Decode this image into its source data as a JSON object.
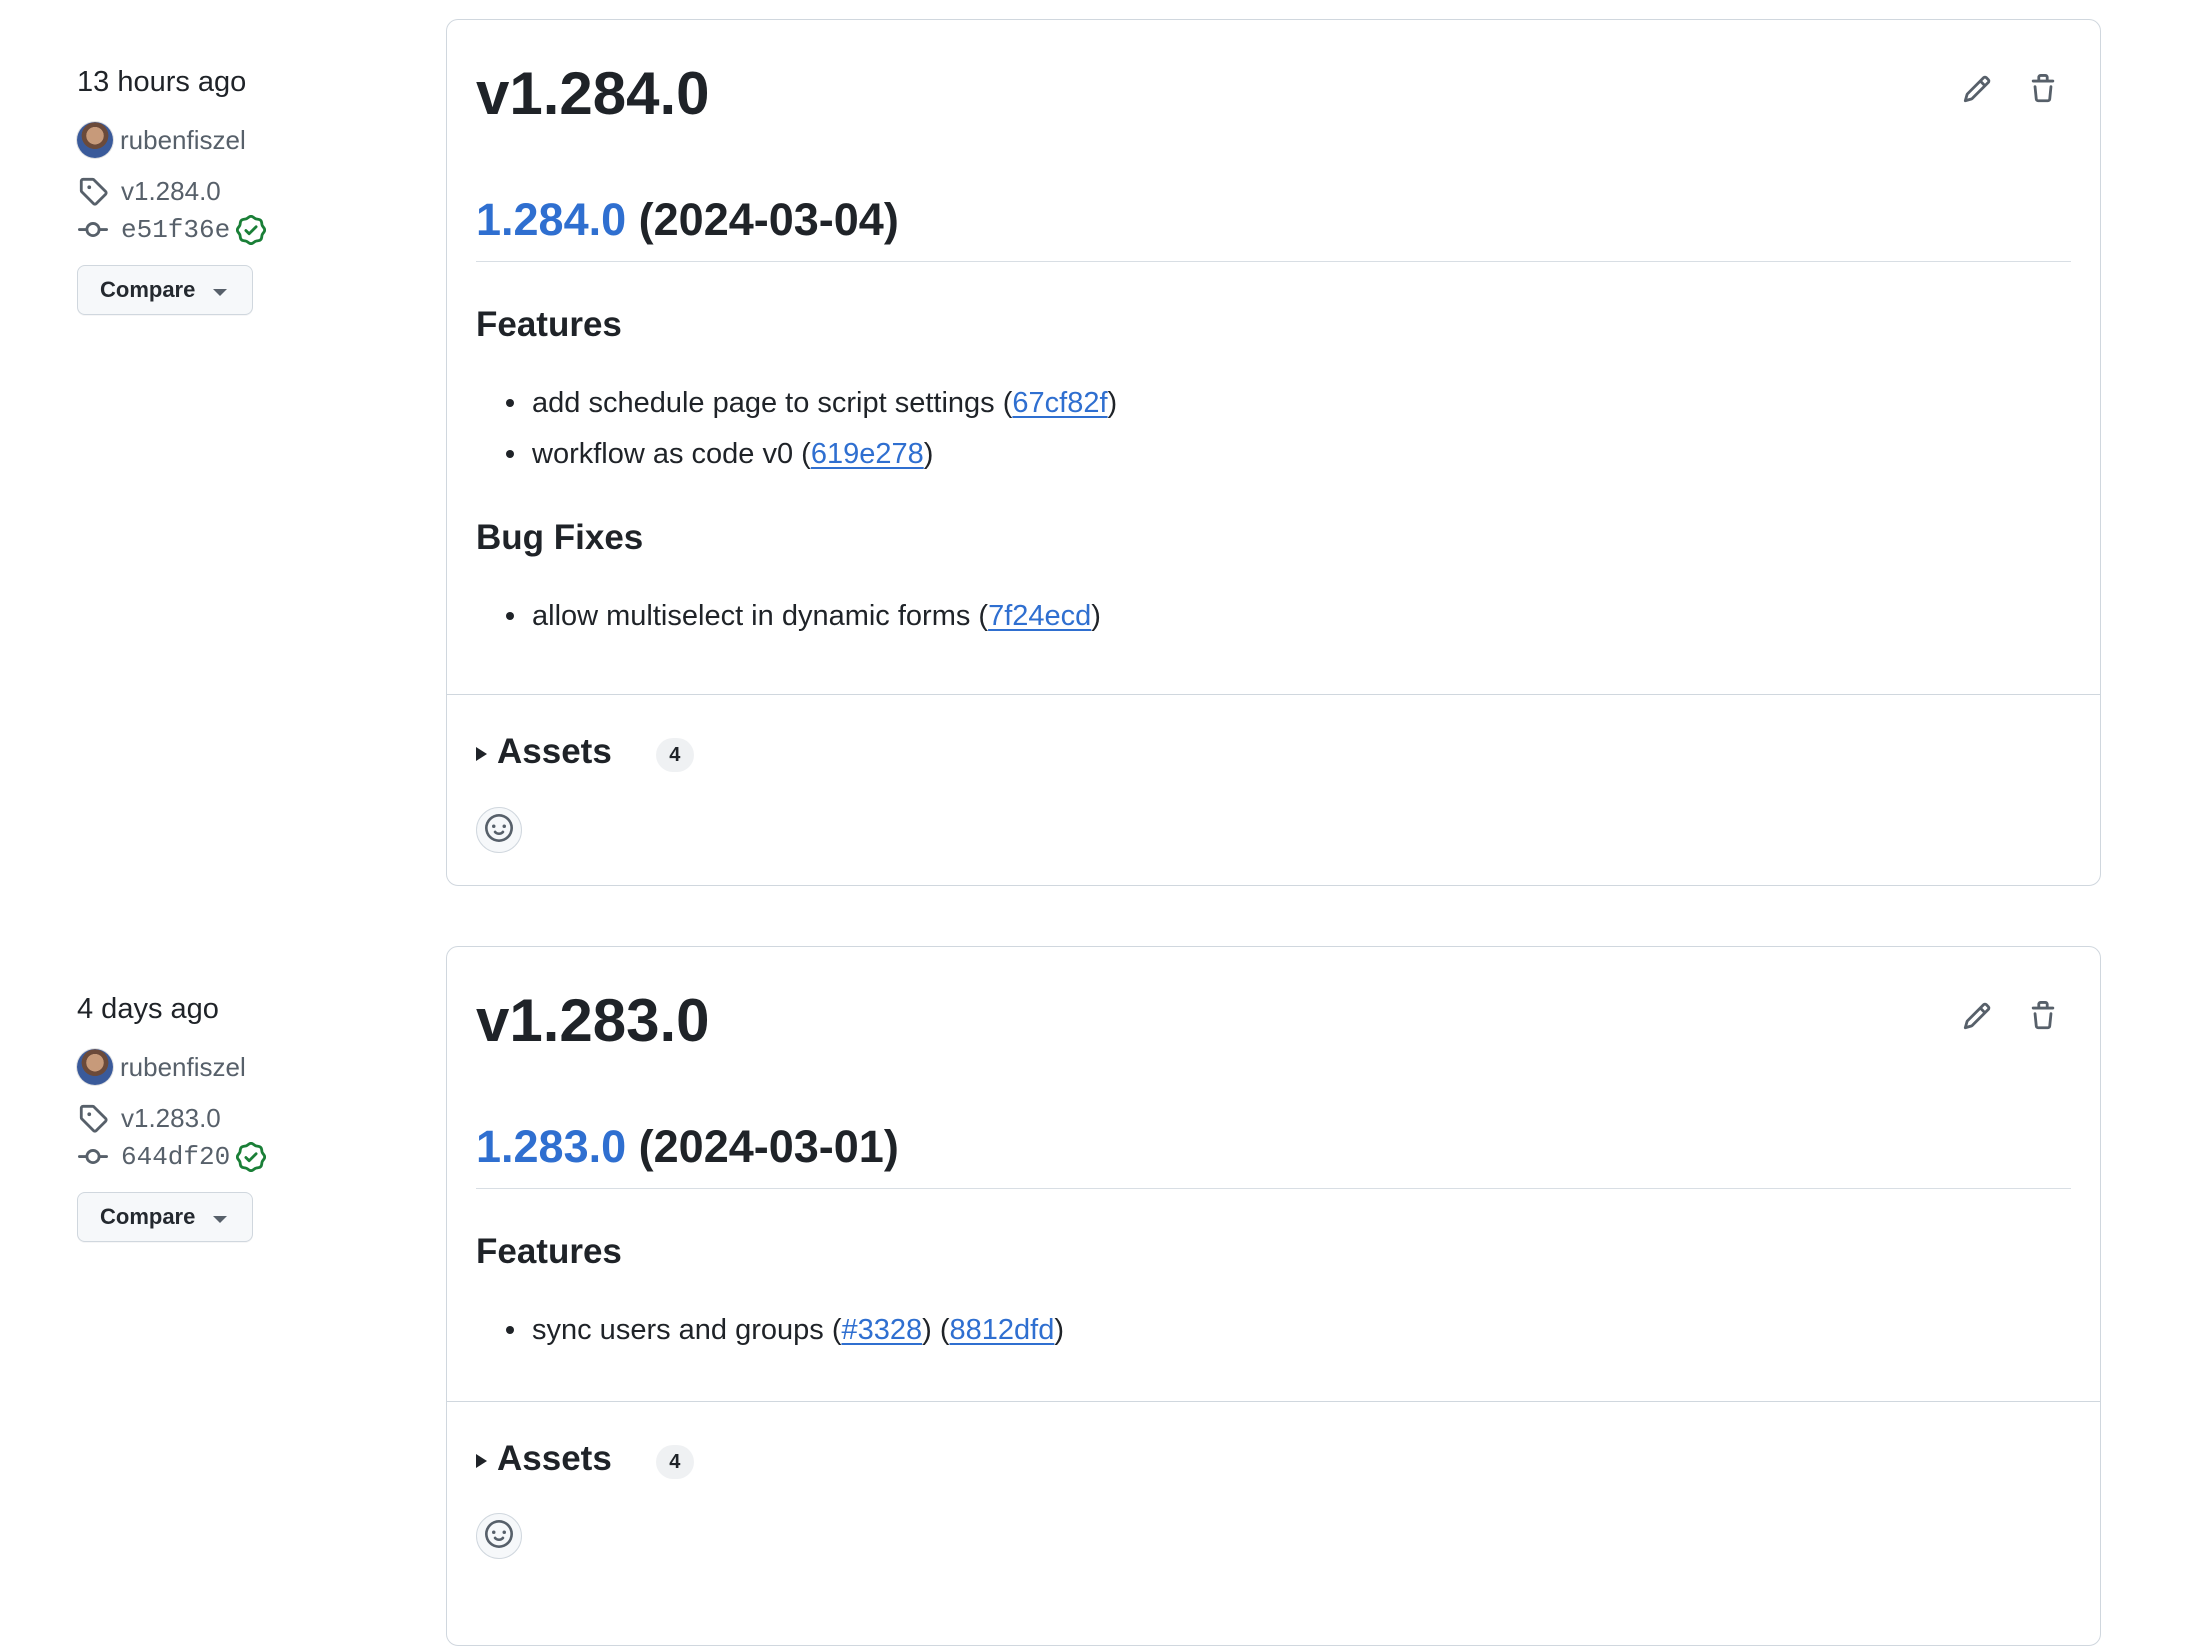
{
  "colors": {
    "link": "#2f6fd0",
    "text": "#1f2328",
    "muted": "#57606a",
    "border": "#d0d7de",
    "verified": "#1a7f37"
  },
  "releases": [
    {
      "time_ago": "13 hours ago",
      "author": "rubenfiszel",
      "tag": "v1.284.0",
      "commit": "e51f36e",
      "compare_label": "Compare",
      "title": "v1.284.0",
      "version_link": "1.284.0",
      "version_date": "(2024-03-04)",
      "sections": [
        {
          "heading": "Features",
          "items": [
            {
              "text": "add schedule page to script settings (",
              "links": [
                "67cf82f"
              ],
              "tail": ")"
            },
            {
              "text": "workflow as code v0 (",
              "links": [
                "619e278"
              ],
              "tail": ")"
            }
          ]
        },
        {
          "heading": "Bug Fixes",
          "items": [
            {
              "text": "allow multiselect in dynamic forms (",
              "links": [
                "7f24ecd"
              ],
              "tail": ")"
            }
          ]
        }
      ],
      "assets_label": "Assets",
      "assets_count": "4",
      "icons": {
        "edit": "pencil-icon",
        "delete": "trash-icon",
        "reaction": "smiley-icon"
      }
    },
    {
      "time_ago": "4 days ago",
      "author": "rubenfiszel",
      "tag": "v1.283.0",
      "commit": "644df20",
      "compare_label": "Compare",
      "title": "v1.283.0",
      "version_link": "1.283.0",
      "version_date": "(2024-03-01)",
      "sections": [
        {
          "heading": "Features",
          "items": [
            {
              "text": "sync users and groups (",
              "links": [
                "#3328",
                "8812dfd"
              ],
              "mid": ") (",
              "tail": ")"
            }
          ]
        }
      ],
      "assets_label": "Assets",
      "assets_count": "4",
      "icons": {
        "edit": "pencil-icon",
        "delete": "trash-icon",
        "reaction": "smiley-icon"
      }
    }
  ]
}
